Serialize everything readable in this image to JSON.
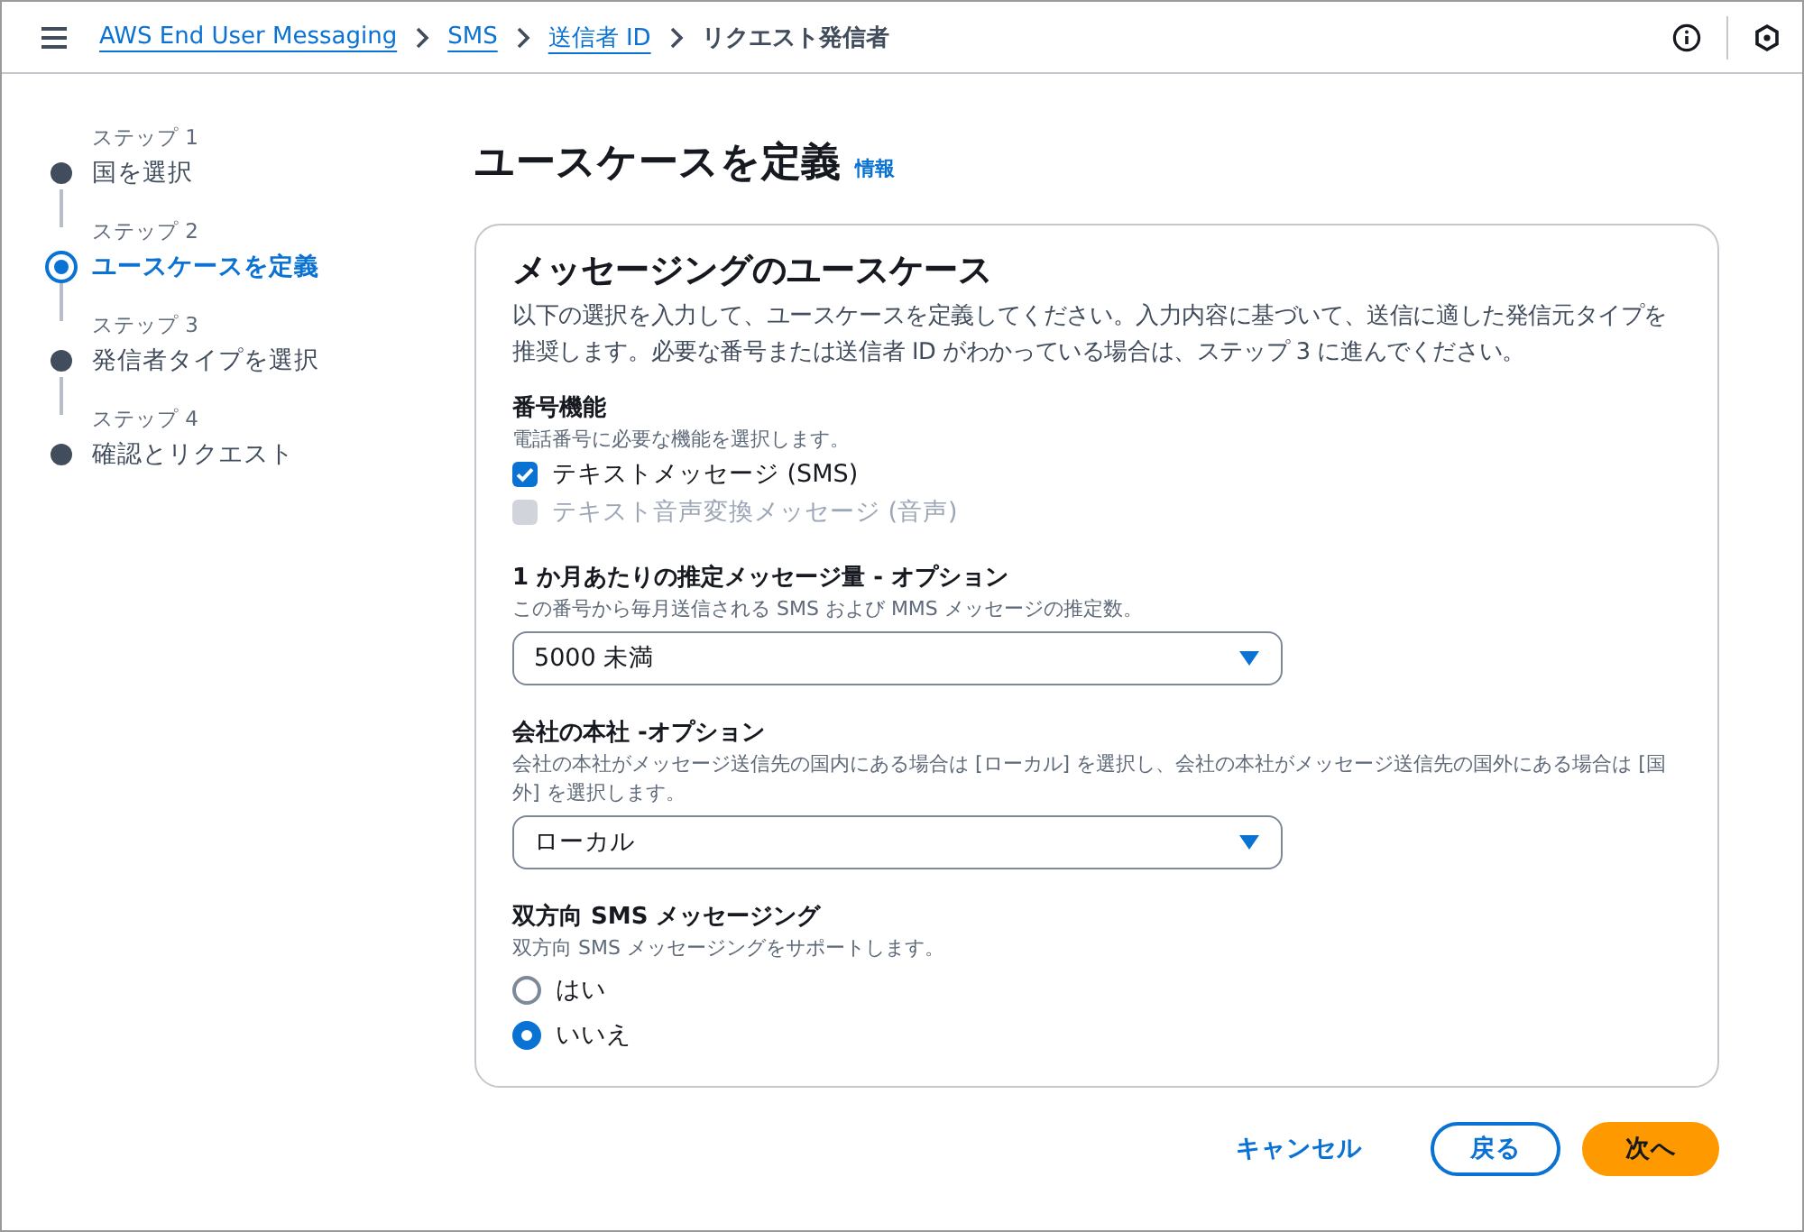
{
  "breadcrumbs": [
    {
      "label": "AWS End User Messaging",
      "link": true
    },
    {
      "label": "SMS",
      "link": true
    },
    {
      "label": "送信者 ID",
      "link": true
    },
    {
      "label": "リクエスト発信者",
      "link": false
    }
  ],
  "steps": [
    {
      "step": "ステップ 1",
      "label": "国を選択",
      "selected": false
    },
    {
      "step": "ステップ 2",
      "label": "ユースケースを定義",
      "selected": true
    },
    {
      "step": "ステップ 3",
      "label": "発信者タイプを選択",
      "selected": false
    },
    {
      "step": "ステップ 4",
      "label": "確認とリクエスト",
      "selected": false
    }
  ],
  "page_title": "ユースケースを定義",
  "info_link": "情報",
  "card": {
    "title": "メッセージングのユースケース",
    "description": "以下の選択を入力して、ユースケースを定義してください。入力内容に基づいて、送信に適した発信元タイプを推奨します。必要な番号または送信者 ID がわかっている場合は、ステップ 3 に進んでください。",
    "sections": [
      {
        "kind": "checkboxes",
        "label": "番号機能",
        "hint": "電話番号に必要な機能を選択します。",
        "options": [
          {
            "label": "テキストメッセージ (SMS)",
            "checked": true,
            "disabled": false
          },
          {
            "label": "テキスト音声変換メッセージ (音声)",
            "checked": false,
            "disabled": true
          }
        ]
      },
      {
        "kind": "select",
        "label": "1 か月あたりの推定メッセージ量 - オプション",
        "hint": "この番号から毎月送信される SMS および MMS メッセージの推定数。",
        "value": "5000 未満"
      },
      {
        "kind": "select",
        "label": "会社の本社 -オプション",
        "hint": "会社の本社がメッセージ送信先の国内にある場合は [ローカル] を選択し、会社の本社がメッセージ送信先の国外にある場合は [国外] を選択します。",
        "value": "ローカル"
      },
      {
        "kind": "radios",
        "label": "双方向 SMS メッセージング",
        "hint": "双方向 SMS メッセージングをサポートします。",
        "options": [
          {
            "label": "はい",
            "selected": false
          },
          {
            "label": "いいえ",
            "selected": true
          }
        ]
      }
    ]
  },
  "buttons": [
    {
      "label": "キャンセル",
      "kind": "link"
    },
    {
      "label": "戻る",
      "kind": "secondary"
    },
    {
      "label": "次へ",
      "kind": "primary"
    }
  ]
}
